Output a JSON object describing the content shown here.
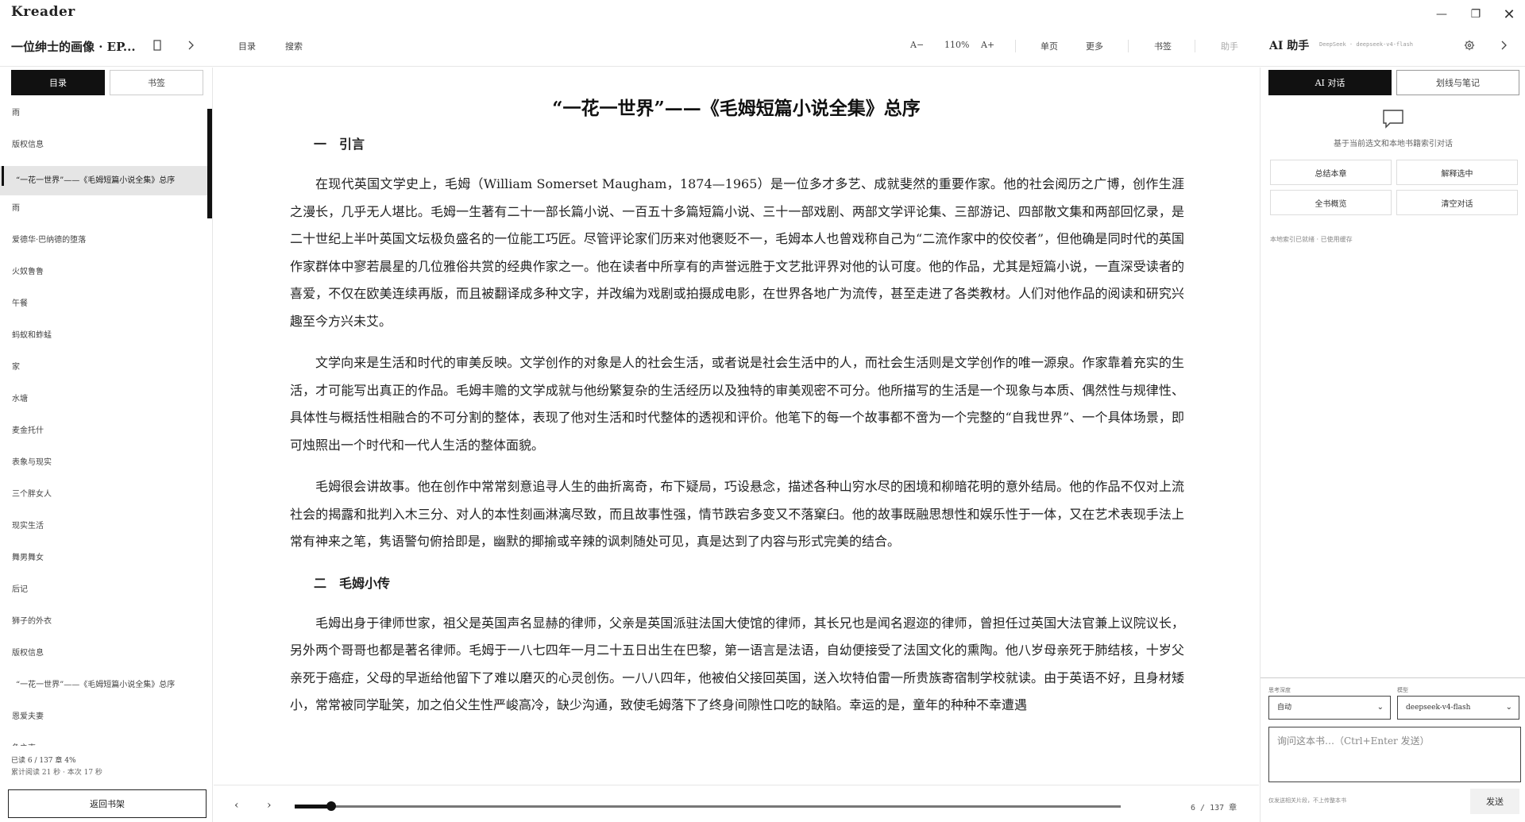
{
  "app": {
    "name": "Kreader",
    "minimize": "—",
    "restore": "❐",
    "close": "✕"
  },
  "toolbar": {
    "book_title": "一位绅士的画像 · EP...",
    "toc_label": "目录",
    "search_label": "搜索",
    "font_decrease": "A−",
    "zoom": "110%",
    "font_increase": "A+",
    "single_page": "单页",
    "more": "更多",
    "bookmark": "书签",
    "assistant": "助手",
    "ai_title": "AI 助手",
    "ai_model": "DeepSeek · deepseek-v4-flash"
  },
  "sidebar": {
    "tabs": [
      {
        "label": "目录",
        "active": true
      },
      {
        "label": "书签",
        "active": false
      }
    ],
    "toc": [
      {
        "label": "雨",
        "active": false,
        "sub": false
      },
      {
        "label": "版权信息",
        "active": false,
        "sub": false
      },
      {
        "label": "“一花一世界”——《毛姆短篇小说全集》总序",
        "active": true,
        "sub": true
      },
      {
        "label": "雨",
        "active": false,
        "sub": false
      },
      {
        "label": "爱德华·巴纳德的堕落",
        "active": false,
        "sub": false
      },
      {
        "label": "火奴鲁鲁",
        "active": false,
        "sub": false
      },
      {
        "label": "午餐",
        "active": false,
        "sub": false
      },
      {
        "label": "蚂蚁和蚱蜢",
        "active": false,
        "sub": false
      },
      {
        "label": "家",
        "active": false,
        "sub": false
      },
      {
        "label": "水塘",
        "active": false,
        "sub": false
      },
      {
        "label": "麦金托什",
        "active": false,
        "sub": false
      },
      {
        "label": "表象与现实",
        "active": false,
        "sub": false
      },
      {
        "label": "三个胖女人",
        "active": false,
        "sub": false
      },
      {
        "label": "现实生活",
        "active": false,
        "sub": false
      },
      {
        "label": "舞男舞女",
        "active": false,
        "sub": false
      },
      {
        "label": "后记",
        "active": false,
        "sub": false
      },
      {
        "label": "狮子的外衣",
        "active": false,
        "sub": false
      },
      {
        "label": "版权信息",
        "active": false,
        "sub": false
      },
      {
        "label": "“一花一世界”——《毛姆短篇小说全集》总序",
        "active": false,
        "sub": true
      },
      {
        "label": "恩爱夫妻",
        "active": false,
        "sub": false
      },
      {
        "label": "龟之声",
        "active": false,
        "sub": false
      }
    ],
    "progress_line": "已读 6 / 137 章  4%",
    "time_line": "累计阅读 21 秒 · 本次 17 秒",
    "back_label": "返回书架"
  },
  "reader": {
    "chapter_title": "“一花一世界”——《毛姆短篇小说全集》总序",
    "section1": "一　引言",
    "p1": "在现代英国文学史上，毛姆（William Somerset Maugham，1874—1965）是一位多才多艺、成就斐然的重要作家。他的社会阅历之广博，创作生涯之漫长，几乎无人堪比。毛姆一生著有二十一部长篇小说、一百五十多篇短篇小说、三十一部戏剧、两部文学评论集、三部游记、四部散文集和两部回忆录，是二十世纪上半叶英国文坛极负盛名的一位能工巧匠。尽管评论家们历来对他褒贬不一，毛姆本人也曾戏称自己为“二流作家中的佼佼者”，但他确是同时代的英国作家群体中寥若晨星的几位雅俗共赏的经典作家之一。他在读者中所享有的声誉远胜于文艺批评界对他的认可度。他的作品，尤其是短篇小说，一直深受读者的喜爱，不仅在欧美连续再版，而且被翻译成多种文字，并改编为戏剧或拍摄成电影，在世界各地广为流传，甚至走进了各类教材。人们对他作品的阅读和研究兴趣至今方兴未艾。",
    "p2": "文学向来是生活和时代的审美反映。文学创作的对象是人的社会生活，或者说是社会生活中的人，而社会生活则是文学创作的唯一源泉。作家靠着充实的生活，才可能写出真正的作品。毛姆丰赡的文学成就与他纷繁复杂的生活经历以及独特的审美观密不可分。他所描写的生活是一个现象与本质、偶然性与规律性、具体性与概括性相融合的不可分割的整体，表现了他对生活和时代整体的透视和评价。他笔下的每一个故事都不啻为一个完整的“自我世界”、一个具体场景，即可烛照出一个时代和一代人生活的整体面貌。",
    "p3": "毛姆很会讲故事。他在创作中常常刻意追寻人生的曲折离奇，布下疑局，巧设悬念，描述各种山穷水尽的困境和柳暗花明的意外结局。他的作品不仅对上流社会的揭露和批判入木三分、对人的本性刻画淋漓尽致，而且故事性强，情节跌宕多变又不落窠臼。他的故事既融思想性和娱乐性于一体，又在艺术表现手法上常有神来之笔，隽语警句俯拾即是，幽默的揶揄或辛辣的讽刺随处可见，真是达到了内容与形式完美的结合。",
    "section2": "二　毛姆小传",
    "p4": "毛姆出身于律师世家，祖父是英国声名显赫的律师，父亲是英国派驻法国大使馆的律师，其长兄也是闻名遐迩的律师，曾担任过英国大法官兼上议院议长，另外两个哥哥也都是著名律师。毛姆于一八七四年一月二十五日出生在巴黎，第一语言是法语，自幼便接受了法国文化的熏陶。他八岁母亲死于肺结核，十岁父亲死于癌症，父母的早逝给他留下了难以磨灭的心灵创伤。一八八四年，他被伯父接回英国，送入坎特伯雷一所贵族寄宿制学校就读。由于英语不好，且身材矮小，常常被同学耻笑，加之伯父生性严峻高冷，缺少沟通，致使毛姆落下了终身间隙性口吃的缺陷。幸运的是，童年的种种不幸遭遇"
  },
  "bottom": {
    "prev": "‹",
    "next": "›",
    "progress_fraction": 0.04,
    "page_count": "6 / 137 章"
  },
  "ai": {
    "tabs": [
      {
        "label": "AI 对话",
        "active": true
      },
      {
        "label": "划线与笔记",
        "active": false
      }
    ],
    "hint": "基于当前选文和本地书籍索引对话",
    "actions": [
      "总结本章",
      "解释选中",
      "全书概览",
      "清空对话"
    ],
    "status": "本地索引已就绪 · 已使用缓存",
    "depth_label": "思考深度",
    "depth_value": "自动",
    "model_label": "模型",
    "model_value": "deepseek-v4-flash",
    "input_placeholder": "询问这本书…（Ctrl+Enter 发送）",
    "foot_hint": "仅发送相关片段，不上传整本书",
    "send_label": "发送"
  }
}
